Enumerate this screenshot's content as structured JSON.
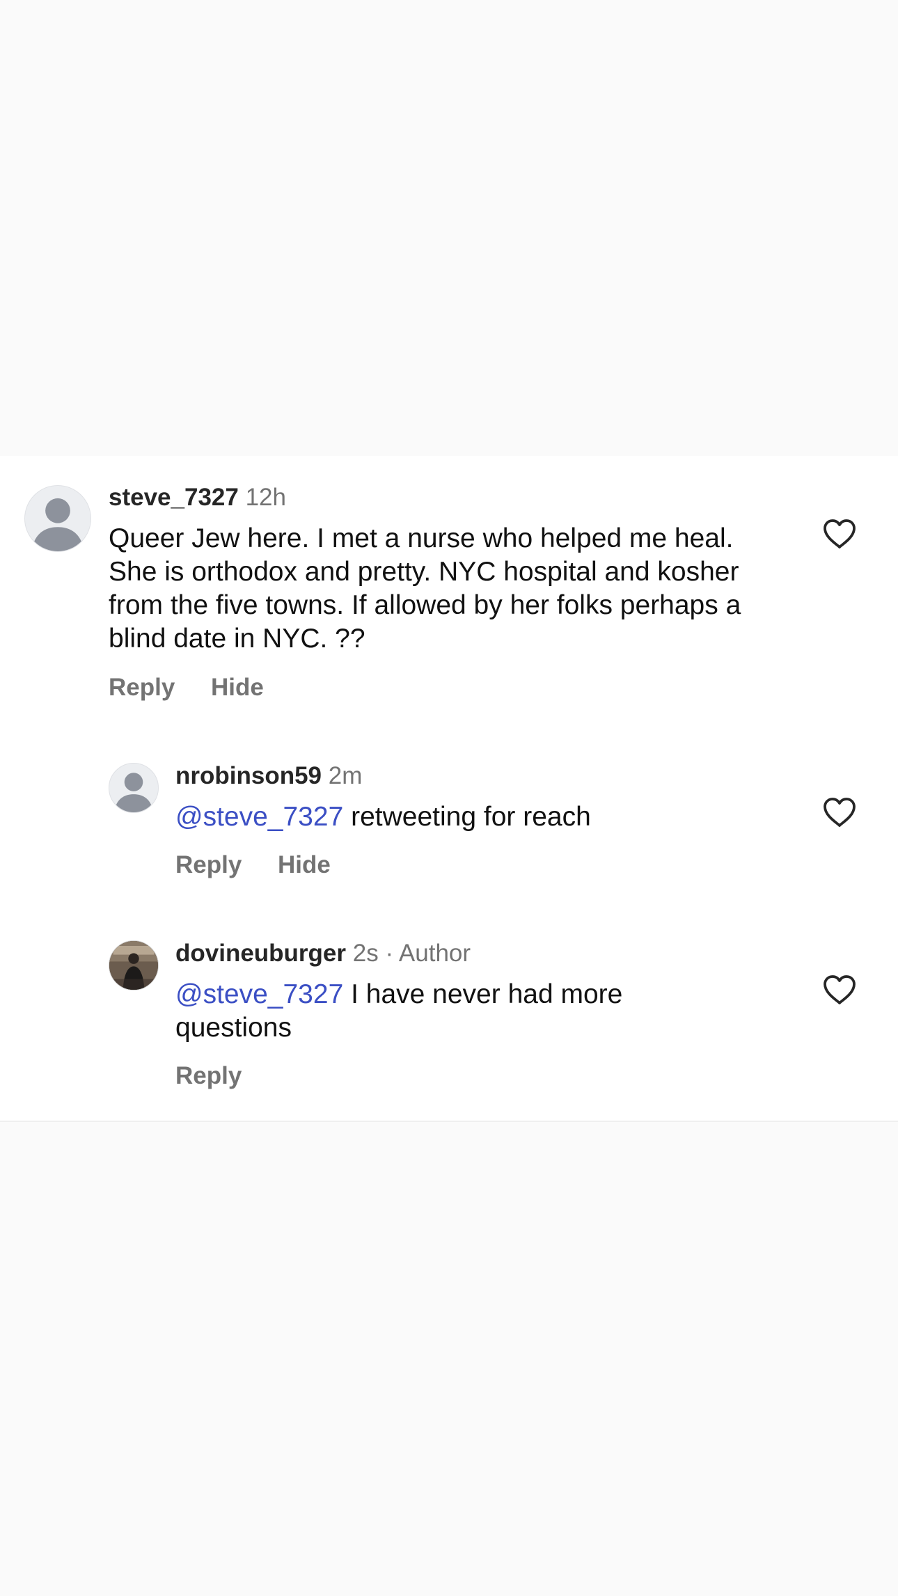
{
  "comments": [
    {
      "username": "steve_7327",
      "time": "12h",
      "text": "Queer Jew here.  I met a nurse who helped me heal.  She is orthodox and pretty.  NYC hospital and kosher from the five towns.  If allowed by her folks perhaps a blind date in NYC. ??",
      "actions": {
        "reply": "Reply",
        "hide": "Hide"
      },
      "avatar_icon": "default-avatar-icon",
      "like_icon": "heart-outline-icon"
    },
    {
      "username": "nrobinson59",
      "time": "2m",
      "mention": "@steve_7327",
      "text": " retweeting for reach",
      "actions": {
        "reply": "Reply",
        "hide": "Hide"
      },
      "avatar_icon": "default-avatar-icon",
      "like_icon": "heart-outline-icon"
    },
    {
      "username": "dovineuburger",
      "time": "2s · Author",
      "mention": "@steve_7327",
      "text_line1": " I have never had more",
      "text_line2": "questions",
      "actions": {
        "reply": "Reply"
      },
      "avatar_icon": "photo-avatar-icon",
      "like_icon": "heart-outline-icon"
    }
  ],
  "colors": {
    "background": "#fafafa",
    "card": "#ffffff",
    "username": "#262626",
    "secondary": "#737373",
    "mention": "#3b4fc4",
    "text": "#111111"
  }
}
